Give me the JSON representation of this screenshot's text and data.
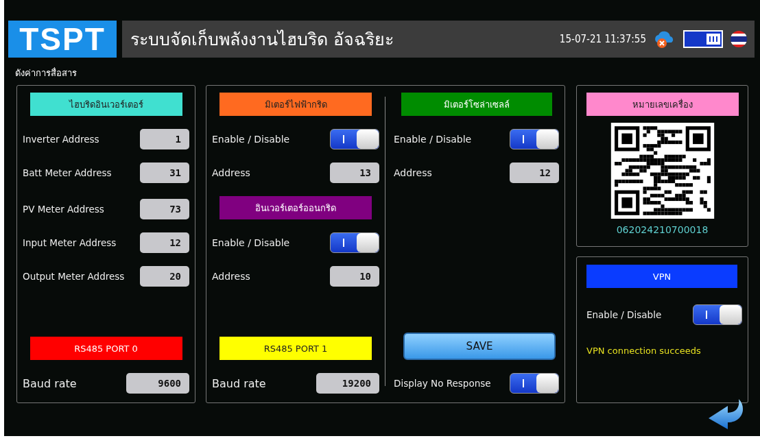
{
  "header": {
    "logo": "TSPT",
    "title": "ระบบจัดเก็บพลังงานไฮบริด อัจฉริยะ",
    "datetime": "15-07-21 11:37:55"
  },
  "page_title": "ดังค่าการสื่อสาร",
  "inverter_panel": {
    "header": {
      "label": "ไฮบริดอินเวอร์เตอร์",
      "color": "#40e0d0"
    },
    "fields": [
      {
        "label": "Inverter Address",
        "value": "1"
      },
      {
        "label": "Batt Meter Address",
        "value": "31"
      },
      {
        "label": "PV Meter Address",
        "value": "73"
      },
      {
        "label": "Input Meter Address",
        "value": "12"
      },
      {
        "label": "Output Meter Address",
        "value": "20"
      }
    ],
    "port": {
      "label": "RS485 PORT 0",
      "color": "#ff0000"
    },
    "baud": {
      "label": "Baud rate",
      "value": "9600"
    }
  },
  "meter_panel": {
    "grid_meter": {
      "header": {
        "label": "มิเตอร์ไฟฟ้ากริด",
        "color": "#ff6a20"
      },
      "toggle": {
        "label": "Enable / Disable",
        "on": true
      },
      "address": {
        "label": "Address",
        "value": "13"
      }
    },
    "ongrid_inverter": {
      "header": {
        "label": "อินเวอร์เตอร์ออนกริด",
        "color": "#800080"
      },
      "toggle": {
        "label": "Enable / Disable",
        "on": true
      },
      "address": {
        "label": "Address",
        "value": "10"
      }
    },
    "port": {
      "label": "RS485 PORT 1",
      "color": "#ffff00"
    },
    "baud": {
      "label": "Baud rate",
      "value": "19200"
    },
    "solar_meter": {
      "header": {
        "label": "มิเตอร์โซล่าเซลล์",
        "color": "#008c00"
      },
      "toggle": {
        "label": "Enable / Disable",
        "on": true
      },
      "address": {
        "label": "Address",
        "value": "12"
      }
    },
    "save_button": "SAVE",
    "no_response": {
      "label": "Display No Response",
      "on": true
    }
  },
  "device_panel": {
    "header": {
      "label": "หมายเลขเครื่อง",
      "color": "#ff88cc"
    },
    "serial": "062024210700018"
  },
  "vpn_panel": {
    "header": {
      "label": "VPN",
      "color": "#0a3cff"
    },
    "toggle": {
      "label": "Enable / Disable",
      "on": true
    },
    "status": "VPN connection succeeds"
  }
}
